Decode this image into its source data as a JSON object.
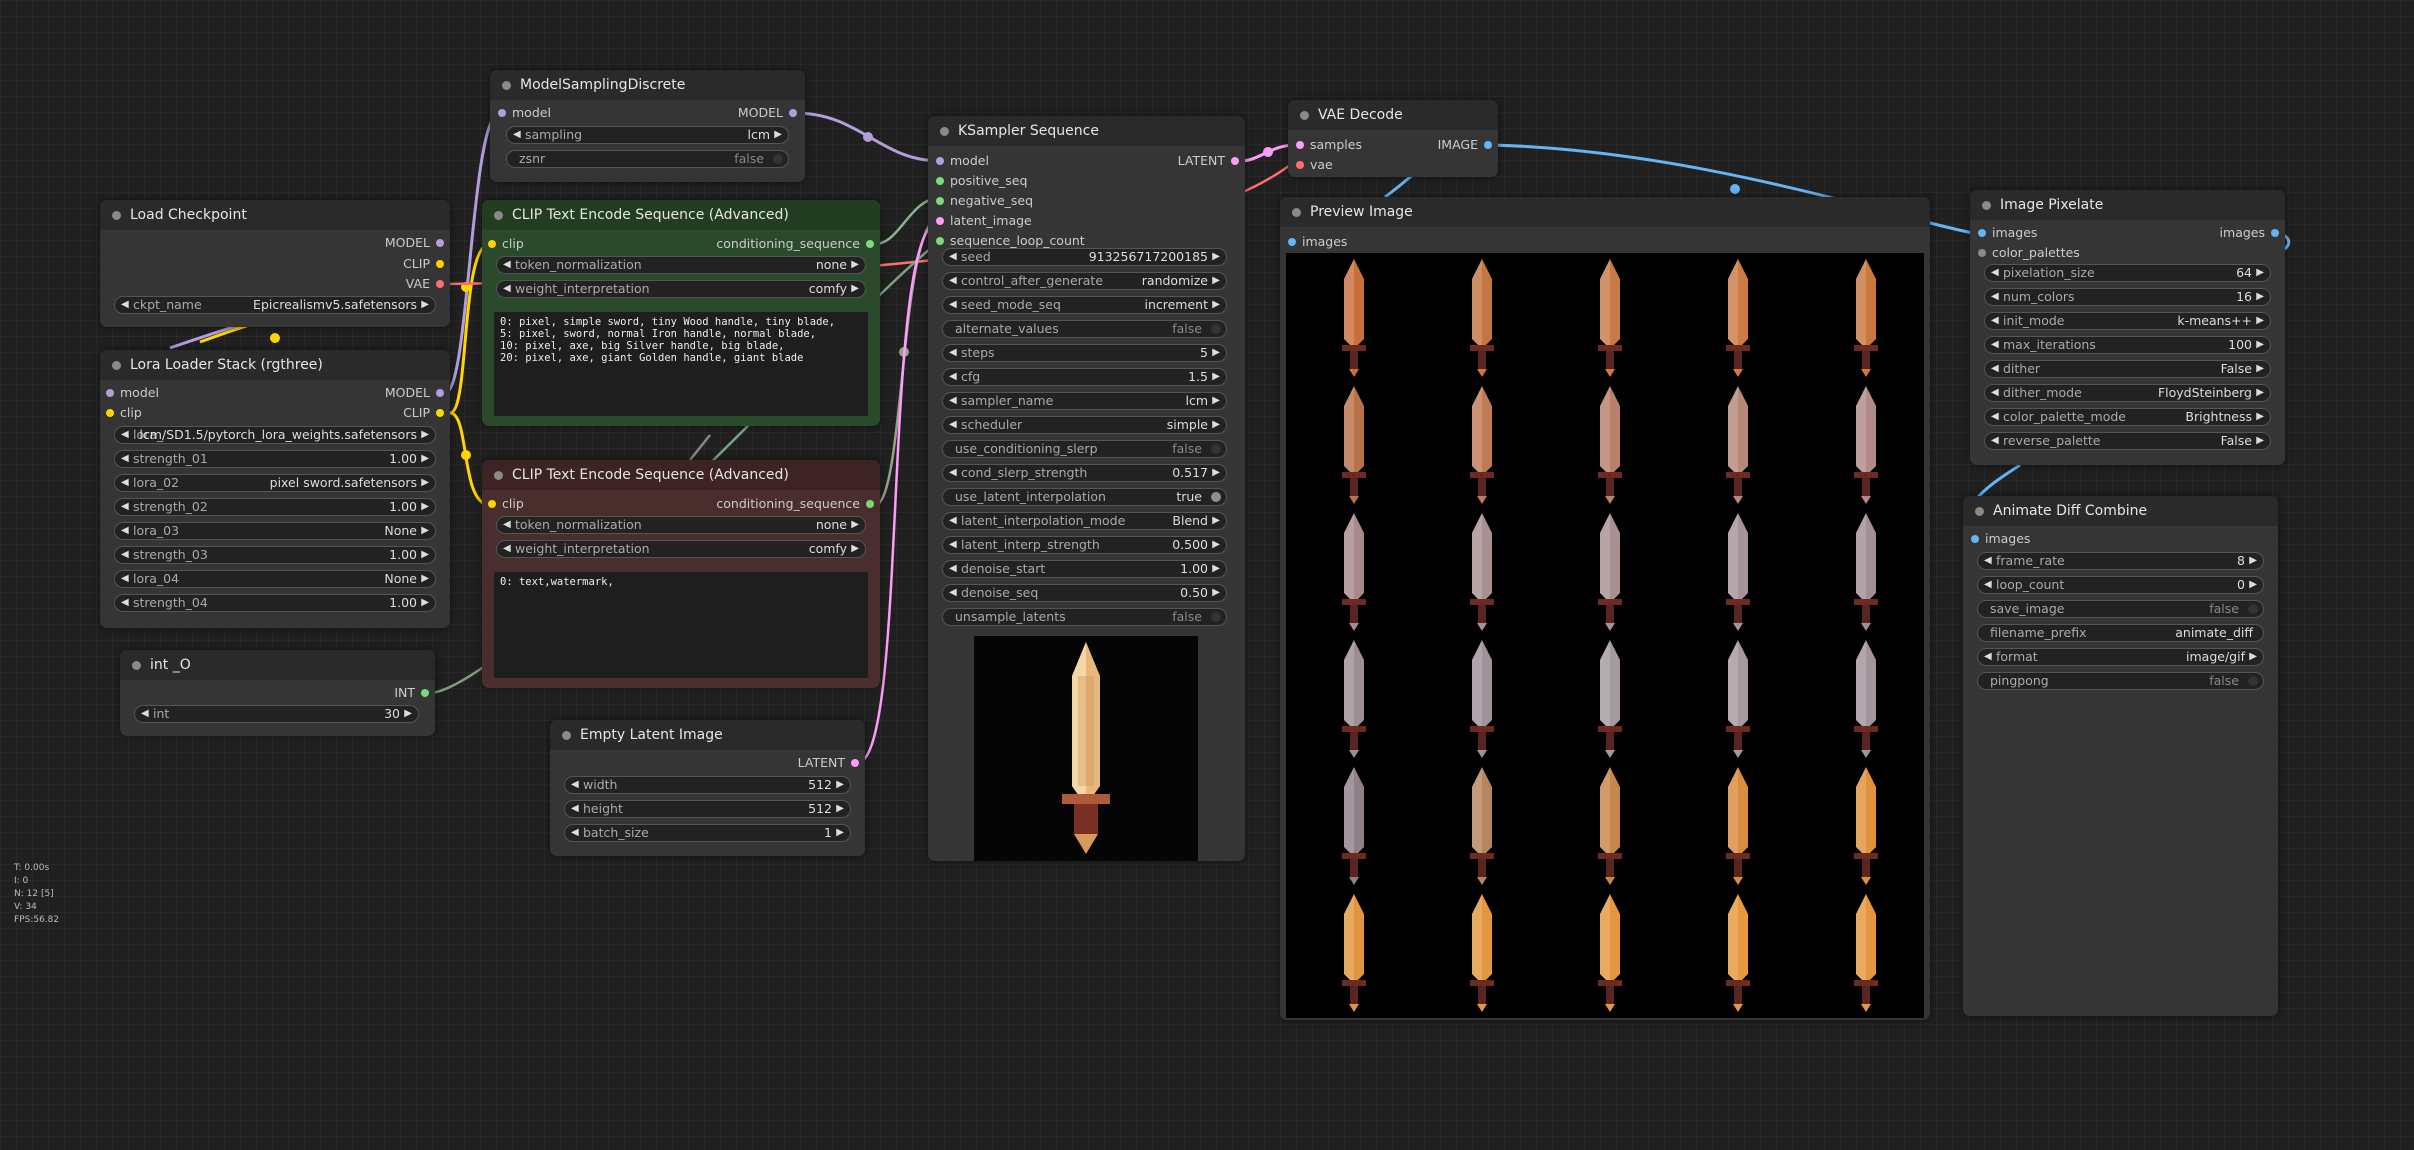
{
  "nodes": {
    "model_sampling": {
      "title": "ModelSamplingDiscrete",
      "in_model": "model",
      "out_model": "MODEL",
      "sampling_label": "sampling",
      "sampling_value": "lcm",
      "zsnr_label": "zsnr",
      "zsnr_value": "false"
    },
    "load_checkpoint": {
      "title": "Load Checkpoint",
      "out_model": "MODEL",
      "out_clip": "CLIP",
      "out_vae": "VAE",
      "ckpt_label": "ckpt_name",
      "ckpt_value": "Epicrealismv5.safetensors"
    },
    "lora_stack": {
      "title": "Lora Loader Stack (rgthree)",
      "in_model": "model",
      "in_clip": "clip",
      "out_model": "MODEL",
      "out_clip": "CLIP",
      "widgets": [
        {
          "label": "lora_",
          "value": "lcm/SD1.5/pytorch_lora_weights.safetensors"
        },
        {
          "label": "strength_01",
          "value": "1.00"
        },
        {
          "label": "lora_02",
          "value": "pixel sword.safetensors"
        },
        {
          "label": "strength_02",
          "value": "1.00"
        },
        {
          "label": "lora_03",
          "value": "None"
        },
        {
          "label": "strength_03",
          "value": "1.00"
        },
        {
          "label": "lora_04",
          "value": "None"
        },
        {
          "label": "strength_04",
          "value": "1.00"
        }
      ]
    },
    "int_node": {
      "title": "int _O",
      "out_int": "INT",
      "int_label": "int",
      "int_value": "30"
    },
    "clip_pos": {
      "title": "CLIP Text Encode Sequence (Advanced)",
      "in_clip": "clip",
      "out_cond": "conditioning_sequence",
      "tn_label": "token_normalization",
      "tn_value": "none",
      "wi_label": "weight_interpretation",
      "wi_value": "comfy",
      "text": "0: pixel, simple sword, tiny Wood handle, tiny blade,\n5: pixel, sword, normal Iron handle, normal blade,\n10: pixel, axe, big Silver handle, big blade,\n20: pixel, axe, giant Golden handle, giant blade"
    },
    "clip_neg": {
      "title": "CLIP Text Encode Sequence (Advanced)",
      "in_clip": "clip",
      "out_cond": "conditioning_sequence",
      "tn_label": "token_normalization",
      "tn_value": "none",
      "wi_label": "weight_interpretation",
      "wi_value": "comfy",
      "text": "0: text,watermark,"
    },
    "empty_latent": {
      "title": "Empty Latent Image",
      "out_latent": "LATENT",
      "width_label": "width",
      "width_value": "512",
      "height_label": "height",
      "height_value": "512",
      "batch_label": "batch_size",
      "batch_value": "1"
    },
    "ksampler": {
      "title": "KSampler Sequence",
      "in_model": "model",
      "in_pos": "positive_seq",
      "in_neg": "negative_seq",
      "in_latent": "latent_image",
      "in_loop": "sequence_loop_count",
      "out_latent": "LATENT",
      "widgets": [
        {
          "label": "seed",
          "value": "913256717200185",
          "type": "num"
        },
        {
          "label": "control_after_generate",
          "value": "randomize",
          "type": "num"
        },
        {
          "label": "seed_mode_seq",
          "value": "increment",
          "type": "num"
        },
        {
          "label": "alternate_values",
          "value": "false",
          "type": "toggle"
        },
        {
          "label": "steps",
          "value": "5",
          "type": "num"
        },
        {
          "label": "cfg",
          "value": "1.5",
          "type": "num"
        },
        {
          "label": "sampler_name",
          "value": "lcm",
          "type": "num"
        },
        {
          "label": "scheduler",
          "value": "simple",
          "type": "num"
        },
        {
          "label": "use_conditioning_slerp",
          "value": "false",
          "type": "toggle"
        },
        {
          "label": "cond_slerp_strength",
          "value": "0.517",
          "type": "num"
        },
        {
          "label": "use_latent_interpolation",
          "value": "true",
          "type": "toggle_on"
        },
        {
          "label": "latent_interpolation_mode",
          "value": "Blend",
          "type": "num"
        },
        {
          "label": "latent_interp_strength",
          "value": "0.500",
          "type": "num"
        },
        {
          "label": "denoise_start",
          "value": "1.00",
          "type": "num"
        },
        {
          "label": "denoise_seq",
          "value": "0.50",
          "type": "num"
        },
        {
          "label": "unsample_latents",
          "value": "false",
          "type": "toggle"
        }
      ]
    },
    "vae_decode": {
      "title": "VAE Decode",
      "in_samples": "samples",
      "in_vae": "vae",
      "out_image": "IMAGE"
    },
    "preview": {
      "title": "Preview Image",
      "in_images": "images"
    },
    "pixelate": {
      "title": "Image Pixelate",
      "in_images": "images",
      "in_palettes": "color_palettes",
      "out_images": "images",
      "widgets": [
        {
          "label": "pixelation_size",
          "value": "64"
        },
        {
          "label": "num_colors",
          "value": "16"
        },
        {
          "label": "init_mode",
          "value": "k-means++"
        },
        {
          "label": "max_iterations",
          "value": "100"
        },
        {
          "label": "dither",
          "value": "False"
        },
        {
          "label": "dither_mode",
          "value": "FloydSteinberg"
        },
        {
          "label": "color_palette_mode",
          "value": "Brightness"
        },
        {
          "label": "reverse_palette",
          "value": "False"
        }
      ]
    },
    "animate": {
      "title": "Animate Diff Combine",
      "in_images": "images",
      "widgets": [
        {
          "label": "frame_rate",
          "value": "8",
          "type": "num"
        },
        {
          "label": "loop_count",
          "value": "0",
          "type": "num"
        },
        {
          "label": "save_image",
          "value": "false",
          "type": "toggle"
        },
        {
          "label": "filename_prefix",
          "value": "animate_diff",
          "type": "text"
        },
        {
          "label": "format",
          "value": "image/gif",
          "type": "num"
        },
        {
          "label": "pingpong",
          "value": "false",
          "type": "toggle"
        }
      ]
    }
  },
  "stats": [
    "T: 0.00s",
    "I: 0",
    "N: 12 [5]",
    "V: 34",
    "FPS:56.82"
  ],
  "colors": {
    "model": "#b39ddb",
    "clip": "#ffd500",
    "vae": "#ff6e6e",
    "conditioning": "#ffa931",
    "latent": "#ff9cf9",
    "image": "#64b5f6",
    "int": "#7cd97c"
  }
}
